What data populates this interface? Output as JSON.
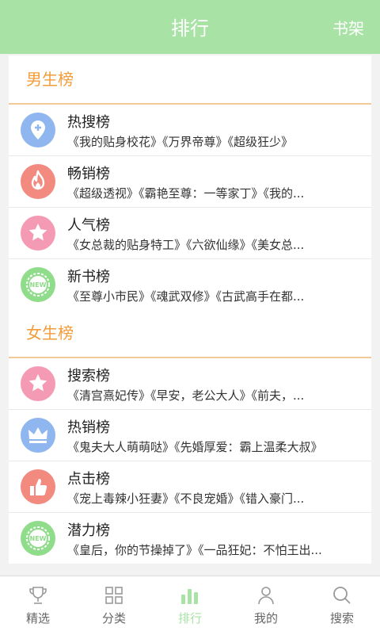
{
  "header": {
    "title": "排行",
    "shelf_label": "书架"
  },
  "sections": [
    {
      "title": "男生榜",
      "rows": [
        {
          "name": "热搜榜",
          "books": "《我的贴身校花》《万界帝尊》《超级狂少》",
          "icon": "location-pin-plus-icon",
          "color": "#8fb6ef"
        },
        {
          "name": "畅销榜",
          "books": "《超级透视》《霸艳至尊：一等家丁》《我的...",
          "icon": "flame-icon",
          "color": "#f28a80"
        },
        {
          "name": "人气榜",
          "books": "《女总裁的贴身特工》《六欲仙缘》《美女总...",
          "icon": "star-icon",
          "color": "#f59ab4"
        },
        {
          "name": "新书榜",
          "books": "《至尊小市民》《魂武双修》《古武高手在都...",
          "icon": "new-badge-icon",
          "color": "#8fdc8a"
        }
      ]
    },
    {
      "title": "女生榜",
      "rows": [
        {
          "name": "搜索榜",
          "books": "《清宫熹妃传》《早安，老公大人》《前夫，...",
          "icon": "star-icon",
          "color": "#f59ab4"
        },
        {
          "name": "热销榜",
          "books": "《鬼夫大人萌萌哒》《先婚厚爱：霸上温柔大叔》",
          "icon": "crown-icon",
          "color": "#8fb6ef"
        },
        {
          "name": "点击榜",
          "books": "《宠上毒辣小狂妻》《不良宠婚》《错入豪门...",
          "icon": "thumbs-up-icon",
          "color": "#f28a80"
        },
        {
          "name": "潜力榜",
          "books": "《皇后，你的节操掉了》《一品狂妃：不怕王出...",
          "icon": "new-badge-icon",
          "color": "#8fdc8a"
        }
      ]
    }
  ],
  "badge_text": "NEW",
  "tabs": [
    {
      "label": "精选",
      "icon": "trophy-icon",
      "active": false
    },
    {
      "label": "分类",
      "icon": "grid-icon",
      "active": false
    },
    {
      "label": "排行",
      "icon": "bar-chart-icon",
      "active": true
    },
    {
      "label": "我的",
      "icon": "user-icon",
      "active": false
    },
    {
      "label": "搜索",
      "icon": "search-icon",
      "active": false
    }
  ],
  "colors": {
    "accent": "#a8e3a5",
    "section_title": "#f29c3a",
    "divider": "#f2c998",
    "inactive_tab": "#999999"
  }
}
